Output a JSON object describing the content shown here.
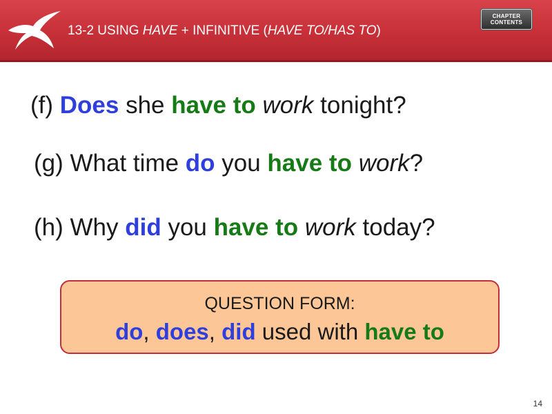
{
  "header": {
    "title_prefix": "13-2  USING ",
    "title_have": "HAVE",
    "title_mid": " + INFINITIVE (",
    "title_paren": "HAVE TO/HAS TO",
    "title_end": ")",
    "chapter_button_line1": "CHAPTER",
    "chapter_button_line2": "CONTENTS"
  },
  "examples": [
    {
      "label": "(f) ",
      "aux": "Does",
      "t1": " she ",
      "have": "have to",
      "t2": " ",
      "verb": "work",
      "t3": " tonight?"
    },
    {
      "label": "(g) What time ",
      "aux": "do",
      "t1": " you ",
      "have": "have to",
      "t2": " ",
      "verb": "work",
      "t3": "?"
    },
    {
      "label": "(h) Why ",
      "aux": "did",
      "t1": " you ",
      "have": "have to",
      "t2": " ",
      "verb": "work",
      "t3": " today?"
    }
  ],
  "note": {
    "title": "QUESTION FORM:",
    "do": "do",
    "sep1": ", ",
    "does": "does",
    "sep2": ", ",
    "did": "did",
    "mid": " used with ",
    "have": "have to"
  },
  "page_number": "14",
  "colors": {
    "header_red": "#c73038",
    "aux_blue": "#2f3fdc",
    "have_green": "#167a16",
    "note_bg": "#fcc697"
  }
}
